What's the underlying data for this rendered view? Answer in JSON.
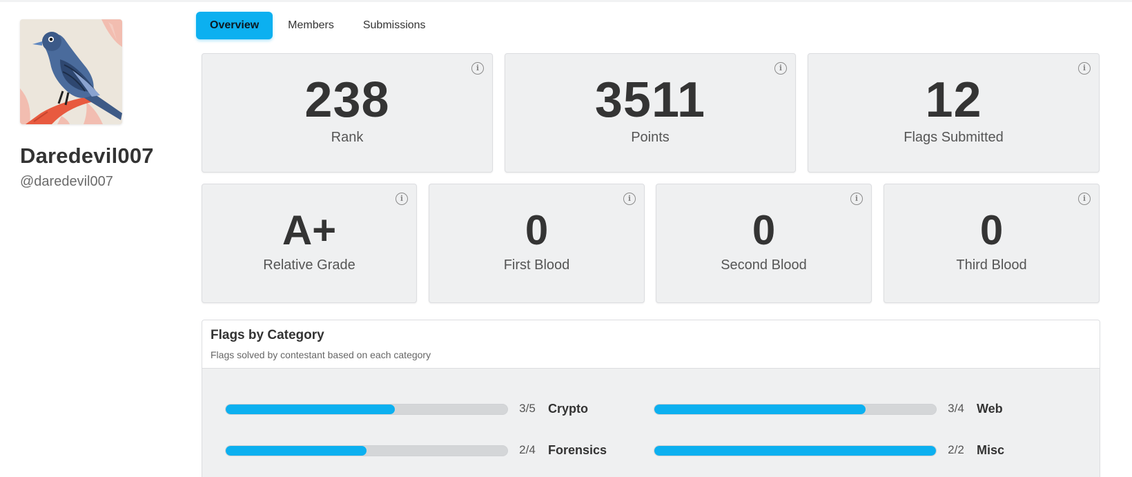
{
  "profile": {
    "display_name": "Daredevil007",
    "handle": "@daredevil007",
    "avatar_icon": "bird-avatar-icon"
  },
  "tabs": [
    {
      "label": "Overview",
      "active": true
    },
    {
      "label": "Members",
      "active": false
    },
    {
      "label": "Submissions",
      "active": false
    }
  ],
  "stats_row1": [
    {
      "value": "238",
      "label": "Rank"
    },
    {
      "value": "3511",
      "label": "Points"
    },
    {
      "value": "12",
      "label": "Flags Submitted"
    }
  ],
  "stats_row2": [
    {
      "value": "A+",
      "label": "Relative Grade"
    },
    {
      "value": "0",
      "label": "First Blood"
    },
    {
      "value": "0",
      "label": "Second Blood"
    },
    {
      "value": "0",
      "label": "Third Blood"
    }
  ],
  "info_icon": "info-icon",
  "flags_by_category": {
    "title": "Flags by Category",
    "subtitle": "Flags solved by contestant based on each category",
    "categories": [
      {
        "name": "Crypto",
        "ratio": "3/5",
        "progress": 0.6
      },
      {
        "name": "Web",
        "ratio": "3/4",
        "progress": 0.75
      },
      {
        "name": "Forensics",
        "ratio": "2/4",
        "progress": 0.5
      },
      {
        "name": "Misc",
        "ratio": "2/2",
        "progress": 1.0
      }
    ]
  },
  "colors": {
    "accent": "#0cb0f0",
    "card_bg": "#eff0f1",
    "track": "#d4d6d8"
  }
}
